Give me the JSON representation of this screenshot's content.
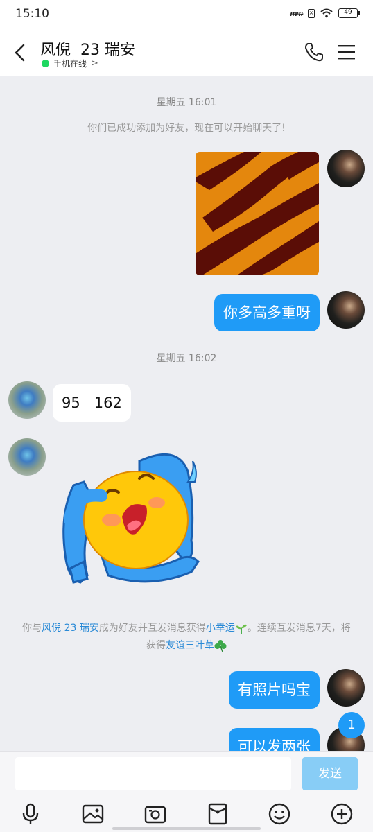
{
  "status_bar": {
    "time": "15:10",
    "signal": "ᵯ",
    "battery": "49"
  },
  "header": {
    "title": "风倪  23 瑞安",
    "status": "手机在线",
    "status_chevron": ">"
  },
  "chat": {
    "time1": "星期五 16:01",
    "system_msg": "你们已成功添加为好友，现在可以开始聊天了!",
    "msg_out_1": "你多高多重呀",
    "time2": "星期五 16:02",
    "msg_in_1": "95   162",
    "notice": {
      "p1": "你与",
      "link1": "风倪  23 瑞安",
      "p2": "成为好友并互发消息获得",
      "link2": "小幸运",
      "p3": "。连续互发消息7天，将获得",
      "link3": "友谊三叶草"
    },
    "msg_out_2": "有照片吗宝",
    "msg_out_3": "可以发两张",
    "unread_count": "1"
  },
  "input": {
    "send_label": "发送",
    "placeholder": ""
  },
  "colors": {
    "accent": "#1f9bf7",
    "send_disabled": "#88cdf6",
    "online": "#1ed760"
  }
}
